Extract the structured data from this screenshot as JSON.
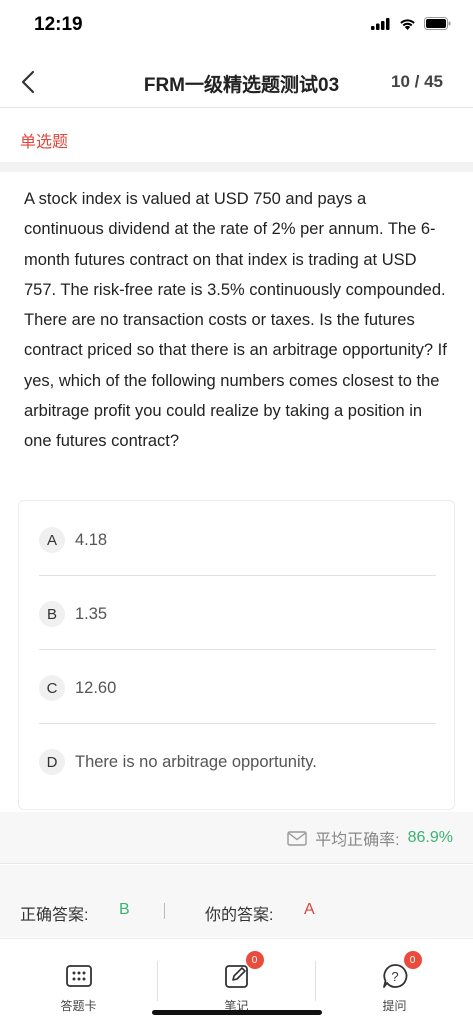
{
  "status_bar": {
    "time": "12:19"
  },
  "nav": {
    "title": "FRM一级精选题测试03",
    "counter": "10 / 45"
  },
  "question": {
    "type": "单选题",
    "text": "A stock index is valued at USD 750 and pays a continuous dividend at the rate of 2% per annum. The 6-month futures contract on that index is trading at USD 757. The risk-free rate is 3.5% continuously compounded. There are no transaction costs or taxes. Is the futures contract priced so that there is an arbitrage opportunity? If yes, which of the following numbers comes closest to the arbitrage profit you could realize by taking a position in one futures contract?"
  },
  "options": [
    {
      "letter": "A",
      "text": "4.18"
    },
    {
      "letter": "B",
      "text": "1.35"
    },
    {
      "letter": "C",
      "text": "12.60"
    },
    {
      "letter": "D",
      "text": "There is no arbitrage opportunity."
    }
  ],
  "stats": {
    "avg_label": "平均正确率:",
    "avg_value": "86.9%"
  },
  "answers": {
    "correct_label": "正确答案:",
    "correct_value": "B",
    "yours_label": "你的答案:",
    "yours_value": "A"
  },
  "tabs": [
    {
      "label": "答题卡",
      "icon": "answer-card-icon"
    },
    {
      "label": "笔记",
      "icon": "note-edit-icon",
      "badge": "0"
    },
    {
      "label": "提问",
      "icon": "question-bubble-icon",
      "badge": "0"
    }
  ],
  "colors": {
    "accent_red": "#e0463c",
    "accent_green": "#3cb371"
  }
}
